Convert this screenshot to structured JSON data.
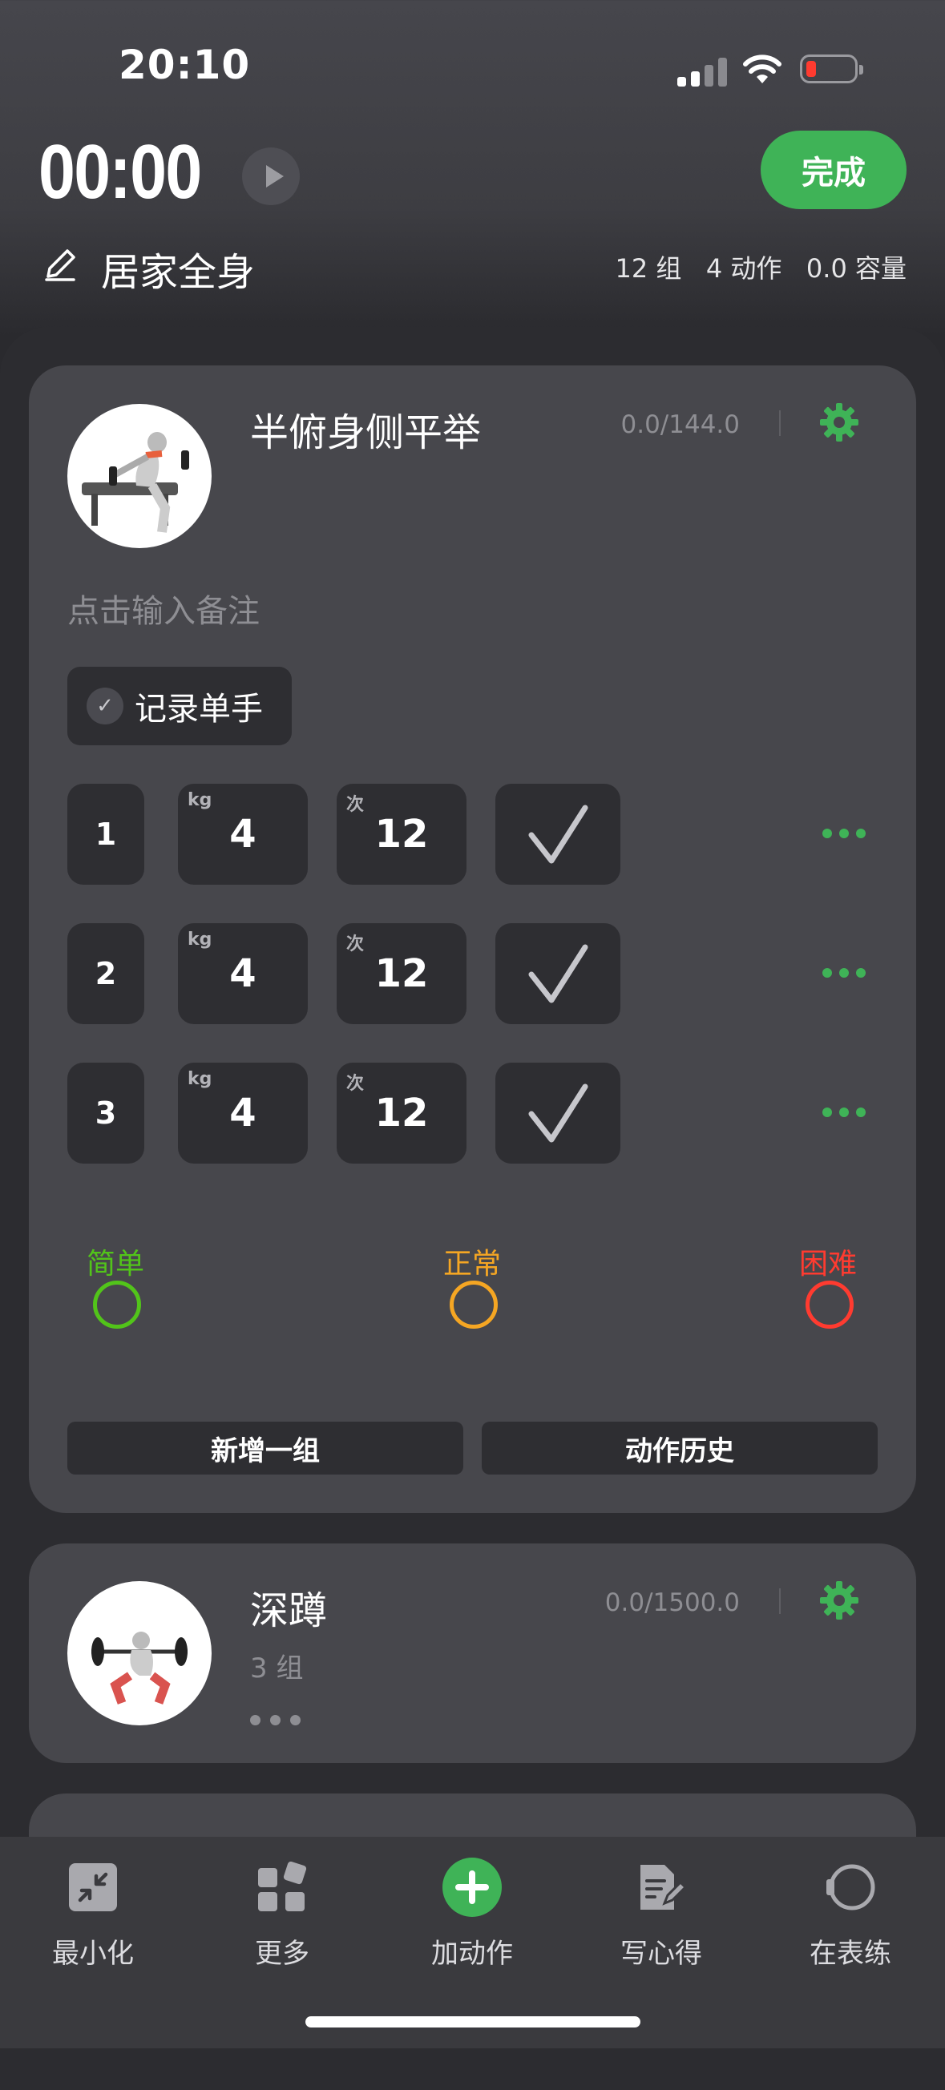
{
  "status_bar": {
    "time": "20:10"
  },
  "workout": {
    "timer": "00:00",
    "finish_label": "完成",
    "title": "居家全身",
    "stats": "12 组   4 动作   0.0 容量"
  },
  "exercise1": {
    "name": "半俯身侧平举",
    "volume": "0.0/144.0",
    "note_placeholder": "点击输入备注",
    "single_hand_label": "记录单手",
    "weight_unit": "kg",
    "reps_unit": "次",
    "sets": [
      {
        "index": "1",
        "weight": "4",
        "reps": "12"
      },
      {
        "index": "2",
        "weight": "4",
        "reps": "12"
      },
      {
        "index": "3",
        "weight": "4",
        "reps": "12"
      }
    ],
    "difficulty": {
      "easy": "简单",
      "normal": "正常",
      "hard": "困难",
      "easy_color": "#52c41a",
      "normal_color": "#f5a623",
      "hard_color": "#ff3b30"
    },
    "add_set_label": "新增一组",
    "history_label": "动作历史"
  },
  "exercise2": {
    "name": "深蹲",
    "volume": "0.0/1500.0",
    "sets_text": "3 组"
  },
  "tabs": [
    {
      "label": "最小化",
      "icon": "minimize-icon"
    },
    {
      "label": "更多",
      "icon": "grid-icon"
    },
    {
      "label": "加动作",
      "icon": "add-icon"
    },
    {
      "label": "写心得",
      "icon": "note-edit-icon"
    },
    {
      "label": "在表练",
      "icon": "watch-icon"
    }
  ],
  "colors": {
    "accent": "#3fb357",
    "card": "#47474c",
    "input": "#2e2e32"
  }
}
